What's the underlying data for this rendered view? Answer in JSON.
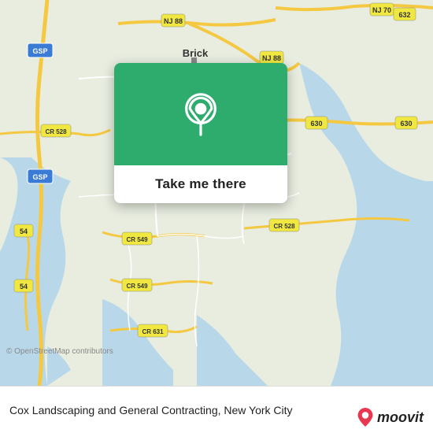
{
  "map": {
    "alt": "Map of Brick, New Jersey area"
  },
  "popup": {
    "button_label": "Take me there"
  },
  "bottom_bar": {
    "copyright": "© OpenStreetMap contributors",
    "location_name": "Cox Landscaping and General Contracting, New York City"
  },
  "moovit": {
    "logo_text": "moovit"
  },
  "colors": {
    "green": "#2eac6d",
    "road_yellow": "#f5d76e",
    "water_blue": "#b0d4e8",
    "land_green": "#e8f0e0",
    "route_label_bg": "#f5d76e"
  }
}
